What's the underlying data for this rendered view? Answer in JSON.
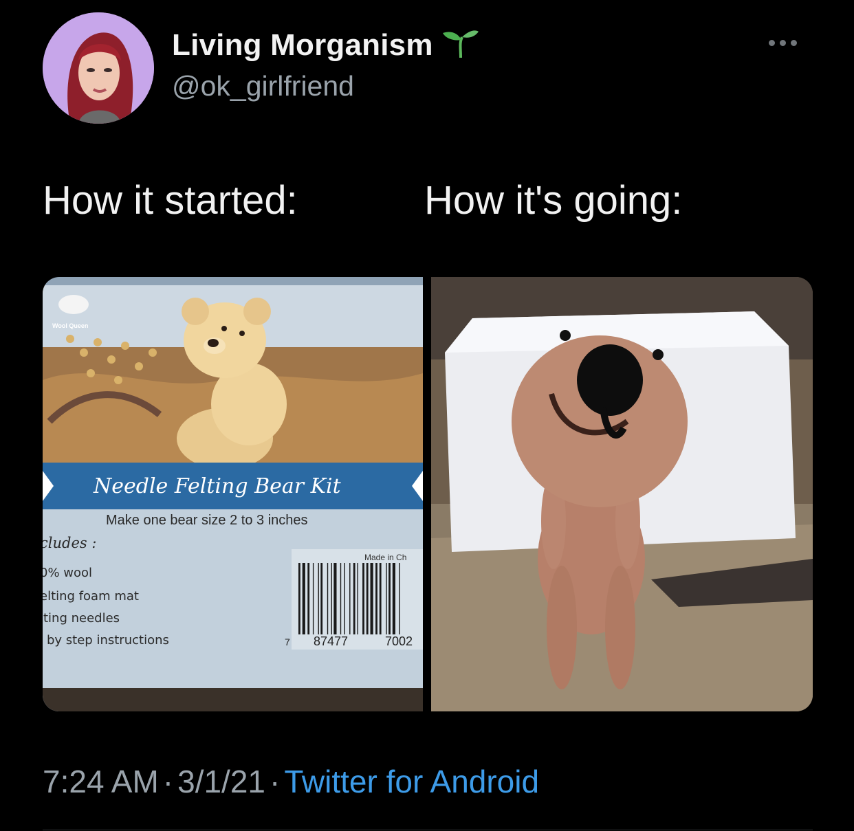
{
  "tweet": {
    "author": {
      "display_name": "Living Morganism",
      "handle": "@ok_girlfriend",
      "badge_icon": "seedling-icon"
    },
    "caption_left": "How it started:",
    "caption_right": "How it's going:",
    "media": {
      "left": {
        "brand": "Wool Queen",
        "product_title": "Needle Felting Bear Kit",
        "subtitle": "Make one bear size 2 to 3 inches",
        "includes_label": "cludes :",
        "includes": [
          "0% wool",
          "elting foam mat",
          "lting needles",
          "by step instructions"
        ],
        "made_in": "Made in Ch",
        "barcode_digits": [
          "7",
          "87477",
          "7002"
        ]
      }
    },
    "timestamp": "7:24 AM",
    "date": "3/1/21",
    "client": "Twitter for Android",
    "separator": "·"
  },
  "colors": {
    "background": "#000000",
    "text": "#f2f2f2",
    "muted": "#9aa3ab",
    "link": "#3d9be8",
    "seedling": "#4caf50"
  }
}
